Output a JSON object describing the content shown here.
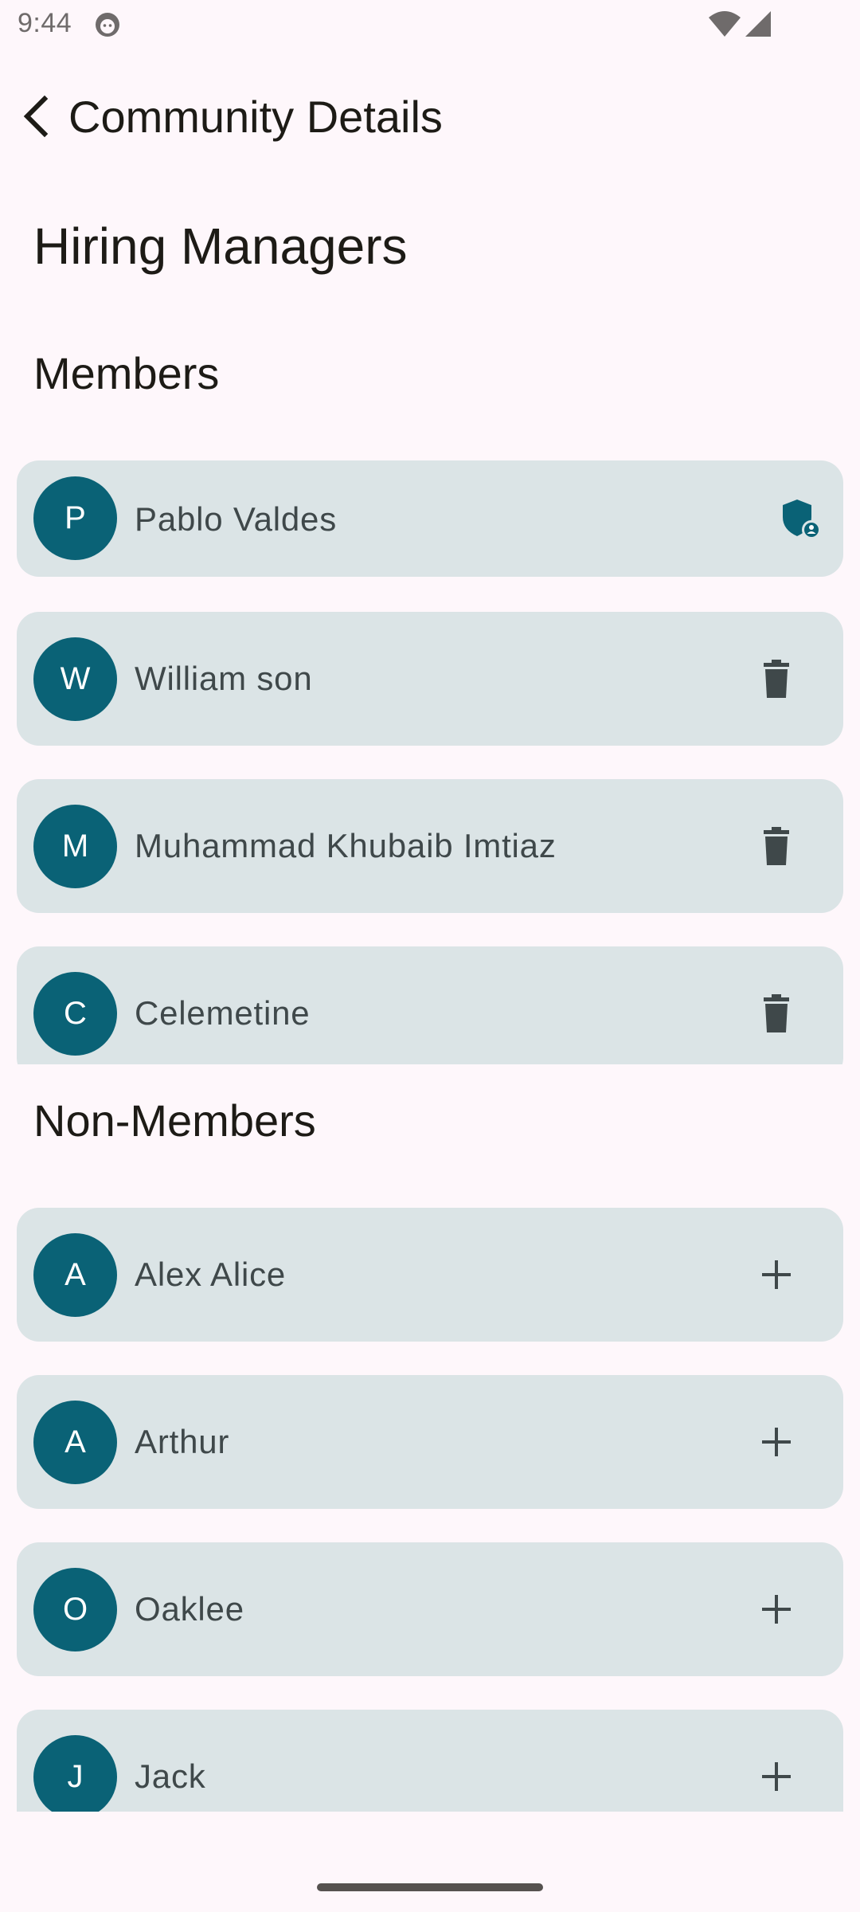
{
  "status_bar": {
    "time": "9:44"
  },
  "app_bar": {
    "title": "Community Details"
  },
  "community": {
    "name": "Hiring Managers"
  },
  "members_section": {
    "title": "Members",
    "items": [
      {
        "initial": "P",
        "name": "Pablo Valdes",
        "action_icon": "admin-shield-icon"
      },
      {
        "initial": "W",
        "name": "William son",
        "action_icon": "delete-icon"
      },
      {
        "initial": "M",
        "name": "Muhammad Khubaib Imtiaz",
        "action_icon": "delete-icon"
      },
      {
        "initial": "C",
        "name": "Celemetine",
        "action_icon": "delete-icon"
      }
    ]
  },
  "non_members_section": {
    "title": "Non-Members",
    "items": [
      {
        "initial": "A",
        "name": "Alex Alice",
        "action_icon": "add-icon"
      },
      {
        "initial": "A",
        "name": "Arthur",
        "action_icon": "add-icon"
      },
      {
        "initial": "O",
        "name": "Oaklee",
        "action_icon": "add-icon"
      },
      {
        "initial": "J",
        "name": "Jack",
        "action_icon": "add-icon"
      }
    ]
  },
  "colors": {
    "background": "#FEF7FB",
    "card": "#DBE4E6",
    "avatar": "#0A6276",
    "icon": "#3f484a"
  }
}
